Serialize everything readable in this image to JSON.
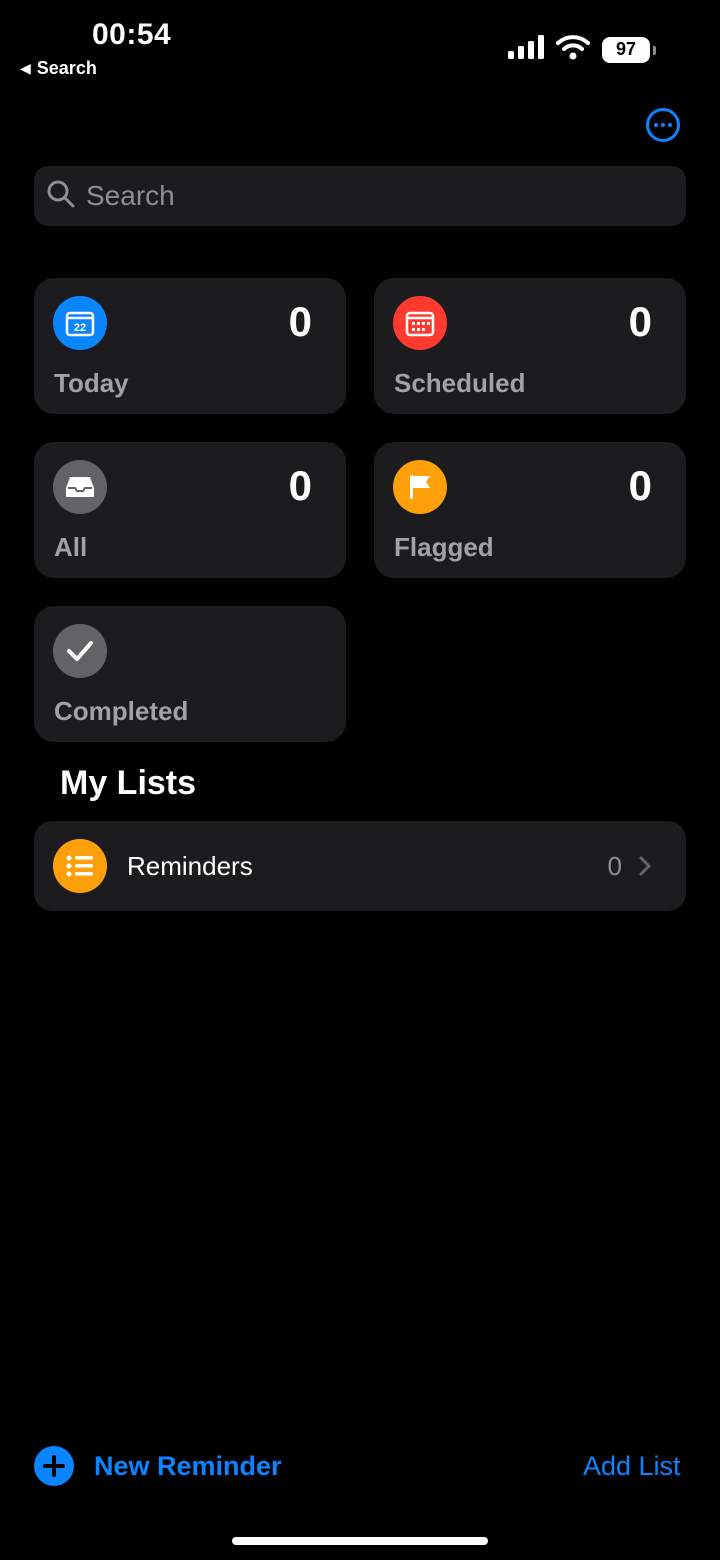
{
  "status_bar": {
    "time": "00:54",
    "back_app": "Search",
    "battery": "97"
  },
  "search": {
    "placeholder": "Search"
  },
  "smart_lists": [
    {
      "label": "Today",
      "count": "0",
      "icon": "calendar-icon",
      "color": "#0a84ff",
      "icon_text": "22"
    },
    {
      "label": "Scheduled",
      "count": "0",
      "icon": "calendar-grid-icon",
      "color": "#ff3b30"
    },
    {
      "label": "All",
      "count": "0",
      "icon": "tray-icon",
      "color": "#636366"
    },
    {
      "label": "Flagged",
      "count": "0",
      "icon": "flag-icon",
      "color": "#ff9f0a"
    },
    {
      "label": "Completed",
      "icon": "checkmark-icon",
      "color": "#636366"
    }
  ],
  "my_lists": {
    "title": "My Lists",
    "items": [
      {
        "name": "Reminders",
        "count": "0",
        "icon": "list-bullet-icon",
        "color": "#ff9f0a"
      }
    ]
  },
  "toolbar": {
    "new_reminder": "New Reminder",
    "add_list": "Add List"
  },
  "colors": {
    "accent": "#0a84ff",
    "background": "#000000",
    "card": "#1c1c1e"
  }
}
